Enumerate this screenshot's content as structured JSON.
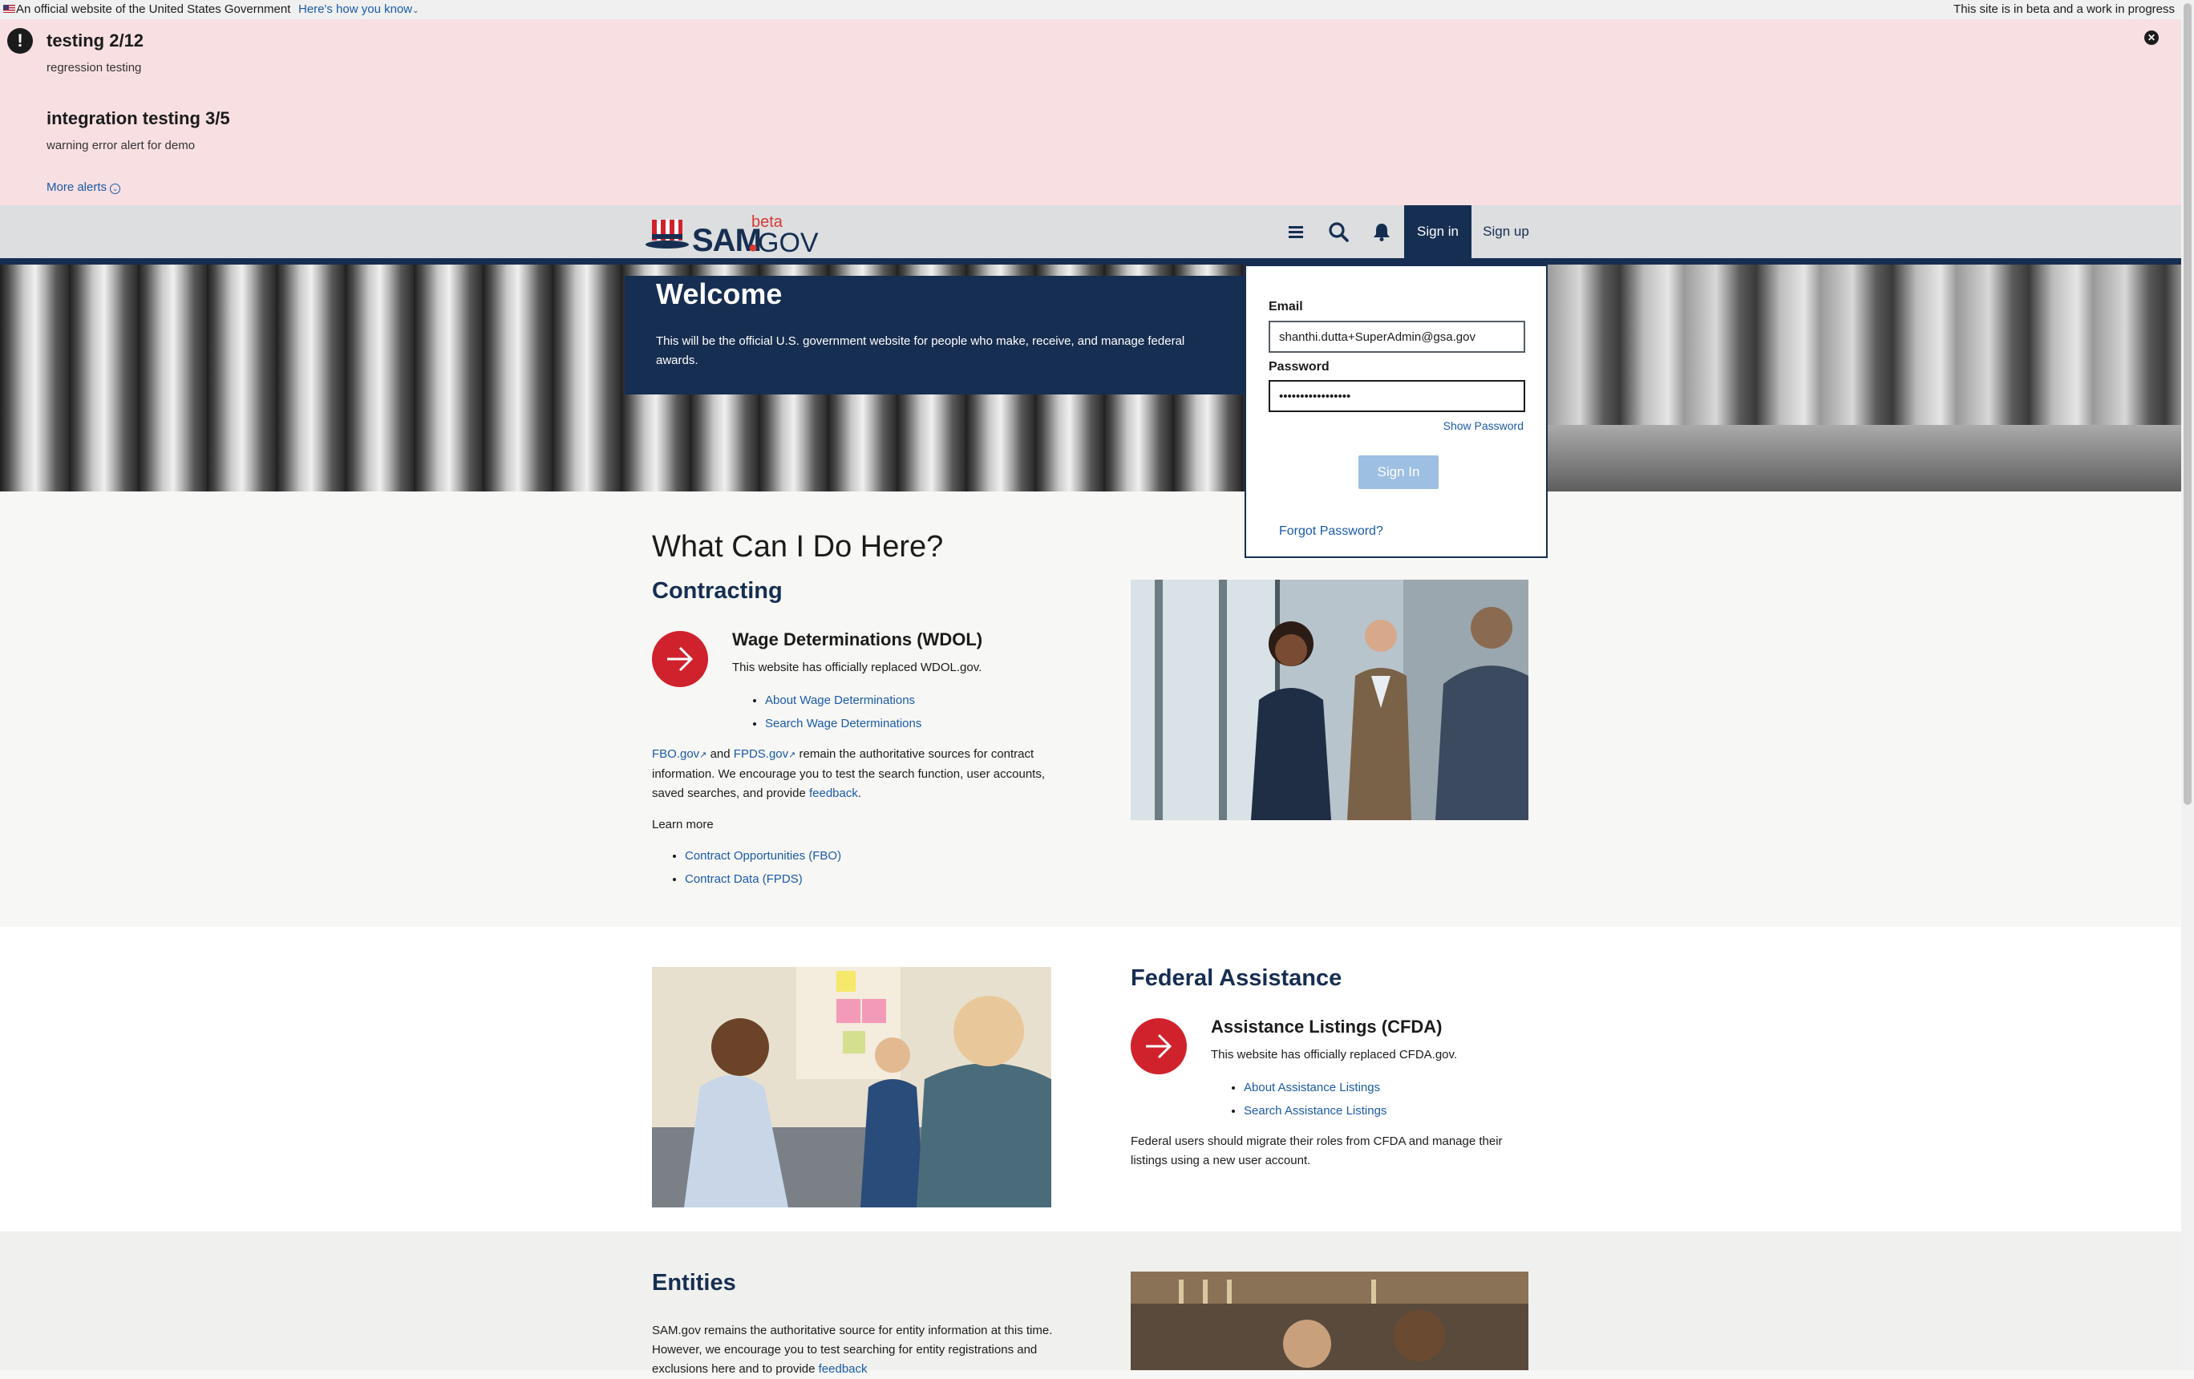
{
  "gov_banner": {
    "official_text": "An official website of the United States Government",
    "how_you_know": "Here's how you know",
    "beta_notice": "This site is in beta and a work in progress"
  },
  "alerts": {
    "items": [
      {
        "title": "testing 2/12",
        "body": "regression testing"
      },
      {
        "title": "integration testing 3/5",
        "body": "warning error alert for demo"
      }
    ],
    "more_alerts": "More alerts"
  },
  "header": {
    "logo_sam": "SAM",
    "logo_gov": "GOV",
    "logo_beta": "beta",
    "sign_in": "Sign in",
    "sign_up": "Sign up"
  },
  "signin": {
    "email_label": "Email",
    "email_value": "shanthi.dutta+SuperAdmin@gsa.gov",
    "password_label": "Password",
    "password_value": "•••••••••••••••••",
    "show_password": "Show Password",
    "submit": "Sign In",
    "forgot": "Forgot Password?"
  },
  "hero": {
    "title": "Welcome",
    "text": "This will be the official U.S. government website for people who make, receive, and manage federal awards."
  },
  "main": {
    "heading": "What Can I Do Here?",
    "contracting": {
      "title": "Contracting",
      "card_title": "Wage Determinations (WDOL)",
      "card_text": "This website has officially replaced WDOL.gov.",
      "links": [
        "About Wage Determinations",
        "Search Wage Determinations"
      ],
      "fbo": "FBO.gov",
      "and": "and",
      "fpds": "FPDS.gov",
      "para_rest": "remain the authoritative sources for contract information. We encourage you to test the search function, user accounts, saved searches, and provide",
      "feedback": "feedback",
      "learn_more": "Learn more",
      "learn_links": [
        "Contract Opportunities (FBO)",
        "Contract Data (FPDS)"
      ]
    },
    "federal_assistance": {
      "title": "Federal Assistance",
      "card_title": "Assistance Listings (CFDA)",
      "card_text": "This website has officially replaced CFDA.gov.",
      "links": [
        "About Assistance Listings",
        "Search Assistance Listings"
      ],
      "para": "Federal users should migrate their roles from CFDA and manage their listings using a new user account."
    },
    "entities": {
      "title": "Entities",
      "para": "SAM.gov remains the authoritative source for entity information at this time. However, we encourage you to test searching for entity registrations and exclusions here and to provide",
      "feedback": "feedback"
    }
  },
  "colors": {
    "navy": "#162e51",
    "red": "#d0222d",
    "alert_bg": "#f8dfe2",
    "link": "#1a5aa8"
  }
}
